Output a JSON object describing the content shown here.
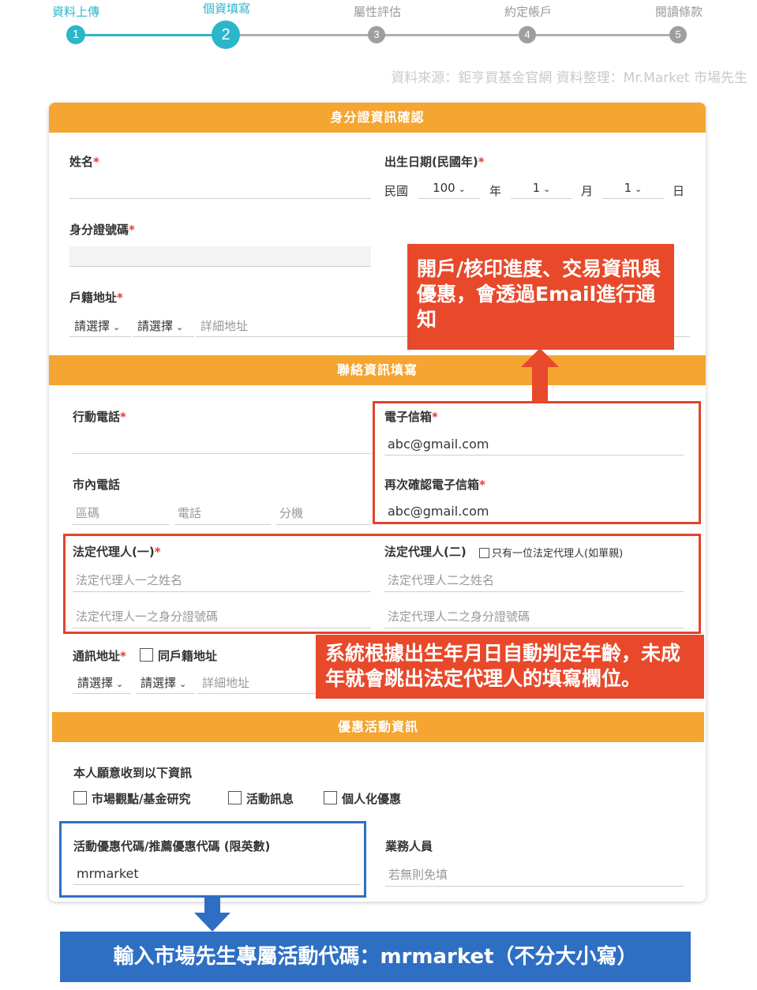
{
  "stepper": {
    "steps": [
      {
        "label": "資料上傳",
        "num": "1"
      },
      {
        "label": "個資填寫",
        "num": "2"
      },
      {
        "label": "屬性評估",
        "num": "3"
      },
      {
        "label": "約定帳戶",
        "num": "4"
      },
      {
        "label": "閱讀條款",
        "num": "5"
      }
    ],
    "active_color": "#2bb6c9",
    "inactive_color": "#9e9e9e"
  },
  "source_note": "資料來源：鉅亨買基金官網  資料整理：Mr.Market 市場先生",
  "identity": {
    "header": "身分證資訊確認",
    "name_label": "姓名",
    "birth_label": "出生日期(民國年)",
    "era": "民國",
    "year": "100",
    "year_unit": "年",
    "month": "1",
    "month_unit": "月",
    "day": "1",
    "day_unit": "日",
    "id_label": "身分證號碼",
    "address_label": "戶籍地址",
    "select1": "請選擇",
    "select2": "請選擇",
    "detail_placeholder": "詳細地址",
    "required_mark": "*"
  },
  "contact": {
    "header": "聯絡資訊填寫",
    "mobile_label": "行動電話",
    "email_label": "電子信箱",
    "email_value": "abc@gmail.com",
    "landline_label": "市內電話",
    "area_placeholder": "區碼",
    "phone_placeholder": "電話",
    "ext_placeholder": "分機",
    "email_confirm_label": "再次確認電子信箱",
    "email_confirm_value": "abc@gmail.com",
    "guardian1_label": "法定代理人(一)",
    "guardian2_label": "法定代理人(二)",
    "single_guardian": "只有一位法定代理人(如單親)",
    "guardian1_name_ph": "法定代理人一之姓名",
    "guardian1_id_ph": "法定代理人一之身分證號碼",
    "guardian2_name_ph": "法定代理人二之姓名",
    "guardian2_id_ph": "法定代理人二之身分證號碼",
    "mail_addr_label": "通訊地址",
    "same_addr": "同戶籍地址",
    "select1": "請選擇",
    "select2": "請選擇",
    "detail_placeholder": "詳細地址"
  },
  "promo": {
    "header": "優惠活動資訊",
    "receive_label": "本人願意收到以下資訊",
    "options": [
      "市場觀點/基金研究",
      "活動訊息",
      "個人化優惠"
    ],
    "code_label": "活動優惠代碼/推薦優惠代碼 (限英數)",
    "code_value": "mrmarket",
    "sales_label": "業務人員",
    "sales_placeholder": "若無則免填"
  },
  "annotations": {
    "email_note": "開戶/核印進度、交易資訊與優惠，會透過Email進行通知",
    "guardian_note": "系統根據出生年月日自動判定年齡，未成年就會跳出法定代理人的填寫欄位。",
    "code_note": "輸入市場先生專屬活動代碼：mrmarket（不分大小寫）",
    "orange_color": "#e8492b",
    "blue_color": "#2f6fc3"
  }
}
